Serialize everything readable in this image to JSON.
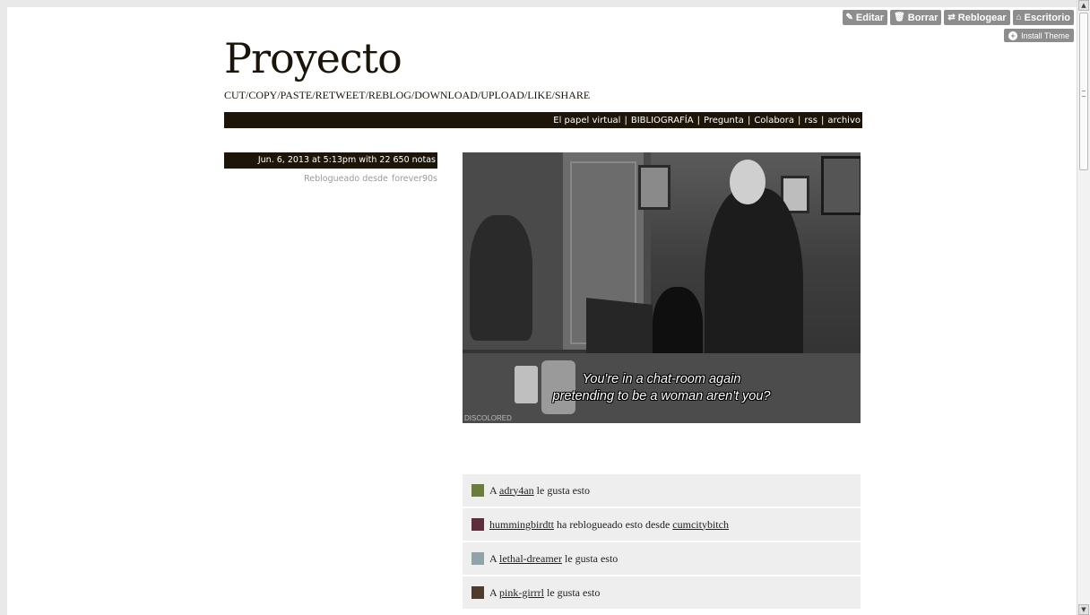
{
  "controls": {
    "edit": "Editar",
    "delete": "Borrar",
    "reblog": "Reblogear",
    "dashboard": "Escritorio",
    "install": "Install Theme"
  },
  "blog": {
    "title": "Proyecto",
    "tagline": "CUT/COPY/PASTE/RETWEET/REBLOG/DOWNLOAD/UPLOAD/LIKE/SHARE"
  },
  "nav": {
    "links": [
      "El papel virtual",
      "BIBLIOGRAFÍA",
      "Pregunta",
      "Colabora",
      "rss",
      "archivo"
    ],
    "separator": "|"
  },
  "post": {
    "date": "Jun. 6, 2013 at 5:13pm with 22 650 notas",
    "reblog_prefix": "Reblogueado desde",
    "reblog_source": "forever90s",
    "caption_line1": "You're in a chat-room again",
    "caption_line2": "pretending to be a woman aren't you?",
    "watermark": "DISCOLORED"
  },
  "notes": [
    {
      "before": "A ",
      "user": "adry4an",
      "after": " le gusta esto",
      "source": "",
      "avatar_color": "#6a7d3a"
    },
    {
      "before": "",
      "user": "hummingbirdtt",
      "after": " ha reblogueado esto desde ",
      "source": "cumcitybitch",
      "avatar_color": "#5c2f3a"
    },
    {
      "before": "A ",
      "user": "lethal-dreamer",
      "after": " le gusta esto",
      "source": "",
      "avatar_color": "#8fa3a8"
    },
    {
      "before": "A ",
      "user": "pink-girrrl",
      "after": " le gusta esto",
      "source": "",
      "avatar_color": "#4e3b2c"
    }
  ]
}
